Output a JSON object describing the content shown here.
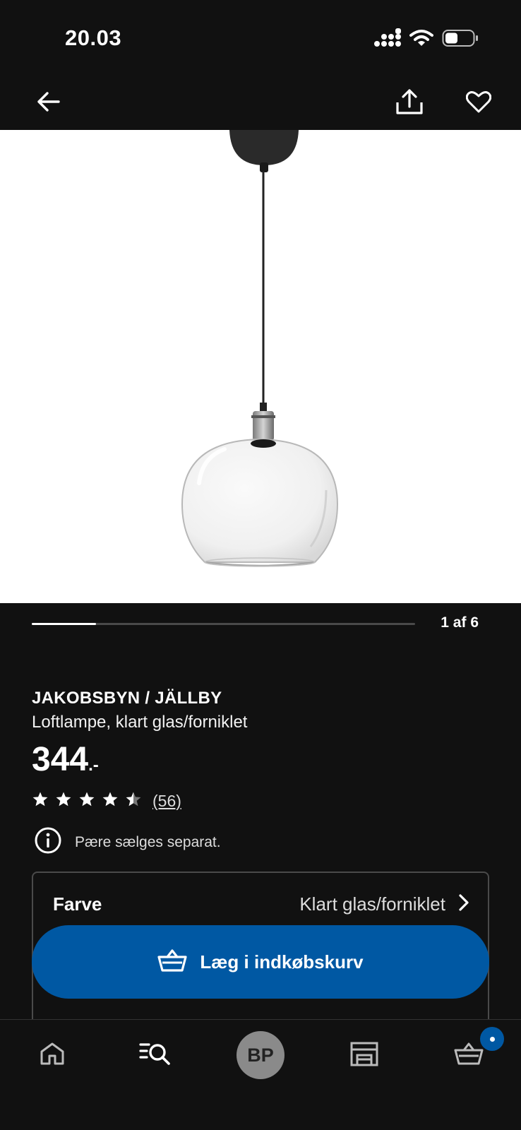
{
  "status": {
    "time": "20.03",
    "icons": [
      "cellular-signal-icon",
      "wifi-icon",
      "battery-icon"
    ]
  },
  "nav": {
    "icons": [
      "back-arrow-icon",
      "share-icon",
      "heart-icon"
    ]
  },
  "gallery": {
    "counter": "1 af 6",
    "progress_fraction": 0.1667
  },
  "product": {
    "brand": "JAKOBSBYN / JÄLLBY",
    "description": "Loftlampe, klart glas/forniklet",
    "price": "344",
    "price_suffix": ".-",
    "rating_value": 4.5,
    "rating_max": 5,
    "rating_count": "(56)",
    "notice": "Pære sælges separat."
  },
  "variant": {
    "label": "Farve",
    "value": "Klart glas/forniklet"
  },
  "cta": {
    "label": "Læg i indkøbskurv"
  },
  "bottom_nav": {
    "tabs": [
      "home-icon",
      "search-icon",
      "profile",
      "store-icon",
      "cart-icon"
    ],
    "avatar_initials": "BP"
  },
  "colors": {
    "background": "#111111",
    "accent_blue": "#0058a3",
    "image_background": "#ffffff"
  }
}
